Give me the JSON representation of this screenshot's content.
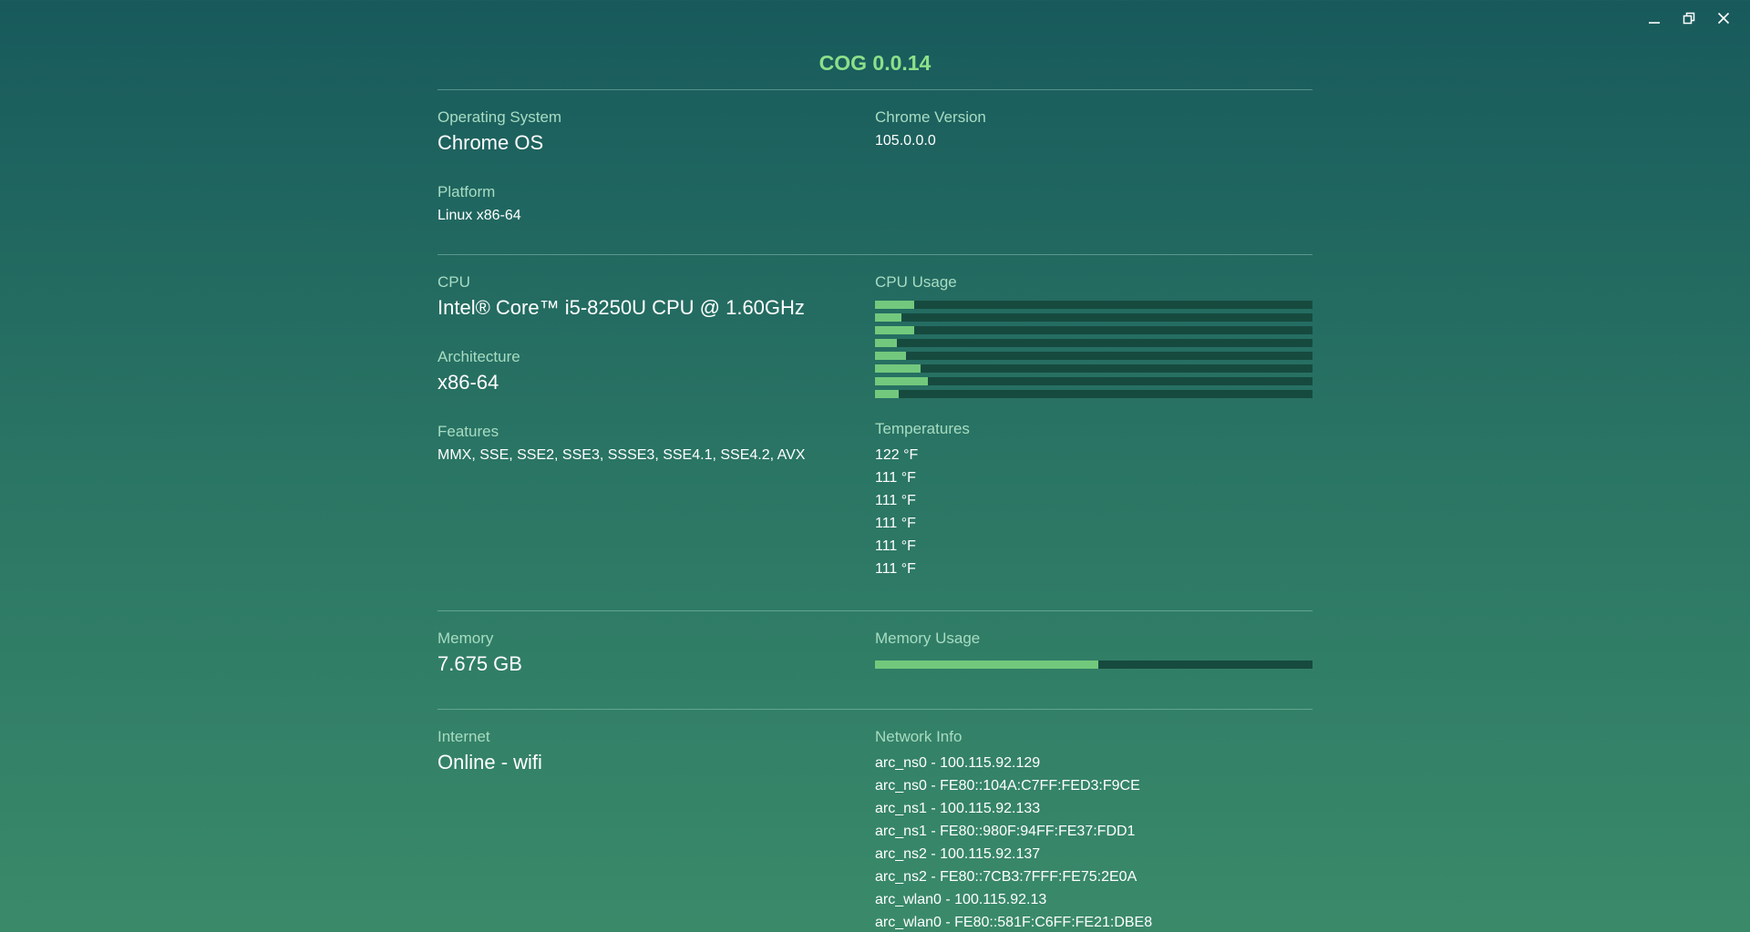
{
  "app": {
    "title": "COG 0.0.14"
  },
  "window_controls": {
    "minimize_icon": "minimize-icon",
    "restore_icon": "restore-icon",
    "close_icon": "close-icon"
  },
  "colors": {
    "accent": "#8de08a",
    "bar_fill": "#72c97d",
    "bar_track": "#174a3f",
    "label": "#a7dcc2"
  },
  "system": {
    "os_label": "Operating System",
    "os_value": "Chrome OS",
    "chrome_label": "Chrome Version",
    "chrome_value": "105.0.0.0",
    "platform_label": "Platform",
    "platform_value": "Linux x86-64"
  },
  "cpu": {
    "label": "CPU",
    "value": "Intel® Core™ i5-8250U CPU @ 1.60GHz",
    "arch_label": "Architecture",
    "arch_value": "x86-64",
    "features_label": "Features",
    "features_value": "MMX, SSE, SSE2, SSE3, SSSE3, SSE4.1, SSE4.2, AVX",
    "usage_label": "CPU Usage",
    "usage_percent": [
      9,
      6,
      9,
      5,
      7,
      10.5,
      12,
      5.5
    ],
    "temps_label": "Temperatures",
    "temps": [
      "122 °F",
      "111 °F",
      "111 °F",
      "111 °F",
      "111 °F",
      "111 °F"
    ]
  },
  "memory": {
    "label": "Memory",
    "value": "7.675 GB",
    "usage_label": "Memory Usage",
    "usage_percent": 51
  },
  "network": {
    "internet_label": "Internet",
    "internet_value": "Online - wifi",
    "info_label": "Network Info",
    "interfaces": [
      "arc_ns0 - 100.115.92.129",
      "arc_ns0 - FE80::104A:C7FF:FED3:F9CE",
      "arc_ns1 - 100.115.92.133",
      "arc_ns1 - FE80::980F:94FF:FE37:FDD1",
      "arc_ns2 - 100.115.92.137",
      "arc_ns2 - FE80::7CB3:7FFF:FE75:2E0A",
      "arc_wlan0 - 100.115.92.13",
      "arc_wlan0 - FE80::581F:C6FF:FE21:DBE8"
    ]
  }
}
